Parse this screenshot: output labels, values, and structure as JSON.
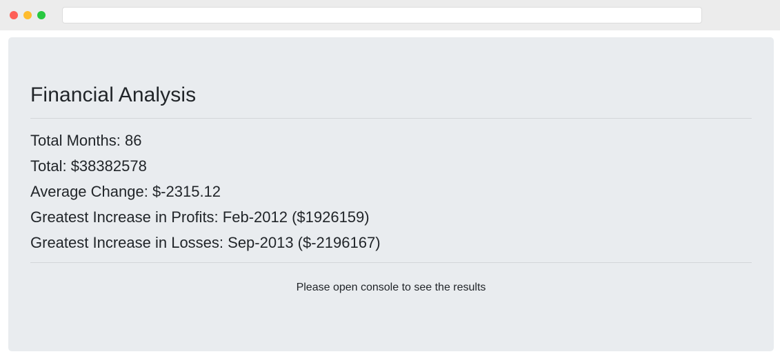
{
  "page": {
    "title": "Financial Analysis",
    "stats": [
      "Total Months: 86",
      "Total: $38382578",
      "Average Change: $-2315.12",
      "Greatest Increase in Profits: Feb-2012 ($1926159)",
      "Greatest Increase in Losses: Sep-2013 ($-2196167)"
    ],
    "footnote": "Please open console to see the results"
  },
  "browser": {
    "address": "",
    "buttons": [
      "close-icon",
      "minimize-icon",
      "maximize-icon"
    ]
  },
  "colors": {
    "jumbotron_bg": "#e9ecef",
    "text": "#212529",
    "close": "#fe5f57",
    "minimize": "#febc2e",
    "maximize": "#28c840"
  }
}
